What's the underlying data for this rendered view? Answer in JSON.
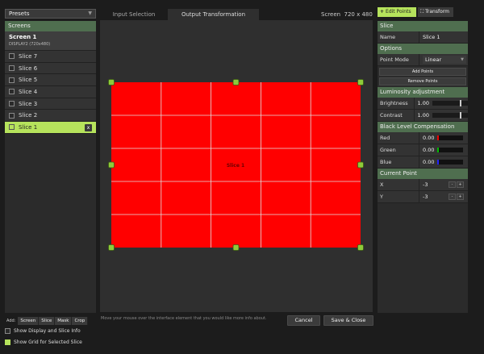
{
  "presets": {
    "label": "Presets"
  },
  "screens": {
    "header": "Screens",
    "screen_name": "Screen 1",
    "screen_sub": "DISPLAY2 (720x480)",
    "slices": [
      {
        "label": "Slice 7",
        "selected": false
      },
      {
        "label": "Slice 6",
        "selected": false
      },
      {
        "label": "Slice 5",
        "selected": false
      },
      {
        "label": "Slice 4",
        "selected": false
      },
      {
        "label": "Slice 3",
        "selected": false
      },
      {
        "label": "Slice 2",
        "selected": false
      },
      {
        "label": "Slice 1",
        "selected": true
      }
    ],
    "close_glyph": "x"
  },
  "add_bar": {
    "label": "Add:",
    "buttons": [
      "Screen",
      "Slice",
      "Mask",
      "Crop"
    ]
  },
  "options": {
    "show_display_info": "Show Display and Slice Info",
    "show_grid": "Show Grid for Selected Slice"
  },
  "tabs": {
    "input": "Input Selection",
    "output": "Output Transformation"
  },
  "screen_info": "Screen  720 x 480",
  "canvas": {
    "slice_label": "Slice 1",
    "fill_color": "#ff0000",
    "grid_color": "#e0e0e0",
    "handle_color": "#8ecb3a"
  },
  "hint": "Move your mouse over the interface element that you would like more info about.",
  "buttons": {
    "cancel": "Cancel",
    "save_close": "Save & Close"
  },
  "mode_buttons": {
    "edit_points": "Edit Points",
    "transform": "Transform"
  },
  "slice_panel": {
    "header": "Slice",
    "name_label": "Name",
    "name_value": "Slice 1",
    "options_header": "Options",
    "point_mode_label": "Point Mode",
    "point_mode_value": "Linear",
    "add_points": "Add Points",
    "remove_points": "Remove Points",
    "luminosity_header": "Luminosity adjustment",
    "brightness_label": "Brightness",
    "brightness_value": "1.00",
    "contrast_label": "Contrast",
    "contrast_value": "1.00",
    "black_level_header": "Black Level Compensation",
    "red_label": "Red",
    "red_value": "0.00",
    "green_label": "Green",
    "green_value": "0.00",
    "blue_label": "Blue",
    "blue_value": "0.00",
    "current_point_header": "Current Point",
    "x_label": "X",
    "x_value": "-3",
    "y_label": "Y",
    "y_value": "-3",
    "minus": "-",
    "plus": "+"
  }
}
